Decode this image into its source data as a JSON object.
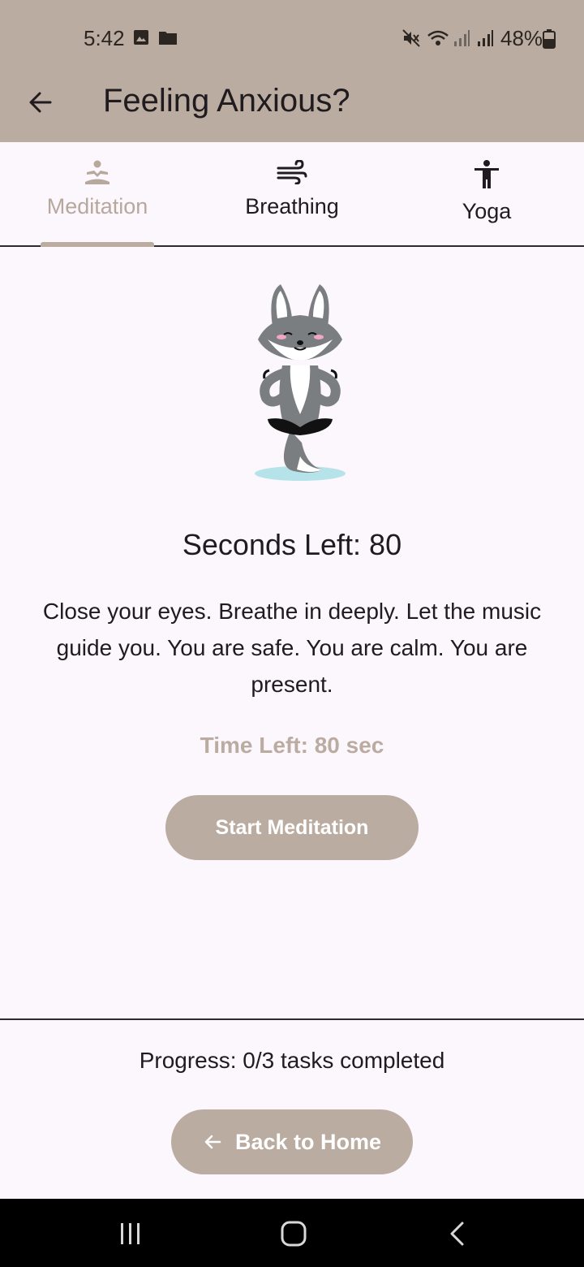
{
  "status_bar": {
    "time": "5:42",
    "battery": "48%",
    "icons": [
      "image-icon",
      "folder-icon",
      "mute-icon",
      "wifi-icon",
      "signal-icon",
      "signal-icon",
      "battery-icon"
    ]
  },
  "app_bar": {
    "title": "Feeling Anxious?",
    "back_icon": "arrow-left-icon"
  },
  "tabs": [
    {
      "label": "Meditation",
      "icon": "meditation-icon",
      "active": true
    },
    {
      "label": "Breathing",
      "icon": "wind-icon",
      "active": false
    },
    {
      "label": "Yoga",
      "icon": "yoga-person-icon",
      "active": false
    }
  ],
  "meditation": {
    "seconds_left": "Seconds Left: 80",
    "instructions": "Close your eyes. Breathe in deeply. Let the music guide you. You are safe. You are calm. You are present.",
    "time_left": "Time Left: 80 sec",
    "start_button": "Start Meditation"
  },
  "footer": {
    "progress": "Progress: 0/3 tasks completed",
    "home_button": "Back to Home"
  },
  "colors": {
    "accent": "#bbaca1",
    "background": "#fcf7fc",
    "text": "#1f1b1e"
  }
}
